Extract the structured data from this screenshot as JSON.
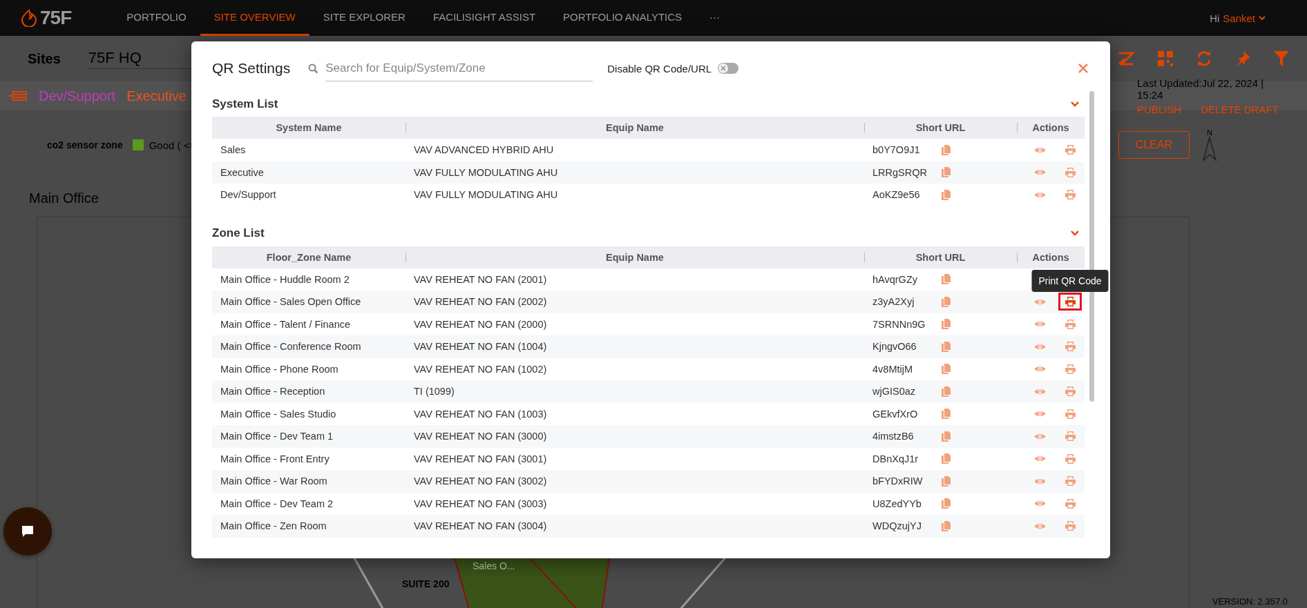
{
  "nav": {
    "logo": "75F",
    "items": [
      {
        "label": "PORTFOLIO",
        "selected": false
      },
      {
        "label": "SITE OVERVIEW",
        "selected": true
      },
      {
        "label": "SITE EXPLORER",
        "selected": false
      },
      {
        "label": "FACILISIGHT ASSIST",
        "selected": false
      },
      {
        "label": "PORTFOLIO ANALYTICS",
        "selected": false
      },
      {
        "label": "···",
        "selected": false
      }
    ],
    "greeting": "Hi",
    "user": "Sanket"
  },
  "site_bar": {
    "label": "Sites",
    "site": "75F HQ"
  },
  "systems": [
    {
      "label": "Dev/Support",
      "color": "#c13bc0"
    },
    {
      "label": "Executive",
      "color": "#f0531c"
    }
  ],
  "last_updated": "Last Updated:Jul 22, 2024 | 15:24",
  "draft_actions": [
    "PUBLISH",
    "DELETE DRAFT"
  ],
  "legend": {
    "title": "co2 sensor zone",
    "items": [
      {
        "label": "Good ( <=",
        "color": "#5a9a1e"
      }
    ]
  },
  "clear_button": "CLEAR",
  "compass": "N",
  "floor": {
    "title": "Main Office",
    "zone_label": "Sales O...",
    "suite_label": "SUITE 200"
  },
  "version": "VERSION: 2.357.0",
  "dialog": {
    "title": "QR Settings",
    "search": {
      "placeholder": "Search for Equip/System/Zone"
    },
    "disable_qr": {
      "label": "Disable QR Code/URL",
      "on": false
    },
    "sections": [
      {
        "title": "System List",
        "expanded": true,
        "columns": [
          "System Name",
          "Equip Name",
          "Short URL",
          "Actions"
        ],
        "rows": [
          {
            "name": "Sales",
            "equip": "VAV ADVANCED HYBRID AHU",
            "short_url": "b0Y7O9J1",
            "highlighted": false
          },
          {
            "name": "Executive",
            "equip": "VAV FULLY MODULATING AHU",
            "short_url": "LRRgSRQR",
            "highlighted": false
          },
          {
            "name": "Dev/Support",
            "equip": "VAV FULLY MODULATING AHU",
            "short_url": "AoKZ9e56",
            "highlighted": false
          }
        ]
      },
      {
        "title": "Zone List",
        "expanded": true,
        "columns": [
          "Floor_Zone Name",
          "Equip Name",
          "Short URL",
          "Actions"
        ],
        "rows": [
          {
            "name": "Main Office - Huddle Room 2",
            "equip": "VAV REHEAT NO FAN (2001)",
            "short_url": "hAvqrGZy",
            "highlighted": false
          },
          {
            "name": "Main Office - Sales Open Office",
            "equip": "VAV REHEAT NO FAN (2002)",
            "short_url": "z3yA2Xyj",
            "highlighted": true,
            "tooltip": "Print QR Code"
          },
          {
            "name": "Main Office - Talent / Finance",
            "equip": "VAV REHEAT NO FAN (2000)",
            "short_url": "7SRNNn9G",
            "highlighted": false
          },
          {
            "name": "Main Office - Conference Room",
            "equip": "VAV REHEAT NO FAN (1004)",
            "short_url": "KjngvO66",
            "highlighted": false
          },
          {
            "name": "Main Office - Phone Room",
            "equip": "VAV REHEAT NO FAN (1002)",
            "short_url": "4v8MtijM",
            "highlighted": false
          },
          {
            "name": "Main Office - Reception",
            "equip": "TI (1099)",
            "short_url": "wjGIS0az",
            "highlighted": false
          },
          {
            "name": "Main Office - Sales Studio",
            "equip": "VAV REHEAT NO FAN (1003)",
            "short_url": "GEkvfXrO",
            "highlighted": false
          },
          {
            "name": "Main Office - Dev Team 1",
            "equip": "VAV REHEAT NO FAN (3000)",
            "short_url": "4imstzB6",
            "highlighted": false
          },
          {
            "name": "Main Office - Front Entry",
            "equip": "VAV REHEAT NO FAN (3001)",
            "short_url": "DBnXqJ1r",
            "highlighted": false
          },
          {
            "name": "Main Office - War Room",
            "equip": "VAV REHEAT NO FAN (3002)",
            "short_url": "bFYDxRIW",
            "highlighted": false
          },
          {
            "name": "Main Office - Dev Team 2",
            "equip": "VAV REHEAT NO FAN (3003)",
            "short_url": "U8ZedYYb",
            "highlighted": false
          },
          {
            "name": "Main Office - Zen Room",
            "equip": "VAV REHEAT NO FAN (3004)",
            "short_url": "WDQzujYJ",
            "highlighted": false
          }
        ]
      }
    ]
  }
}
